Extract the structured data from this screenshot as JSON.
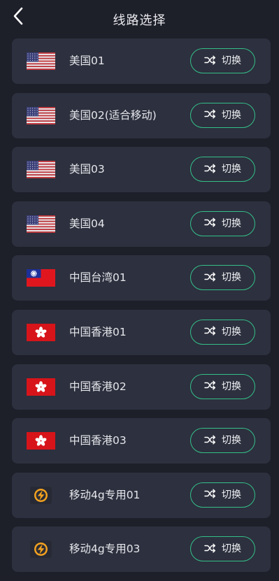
{
  "header": {
    "title": "线路选择",
    "back_icon": "chevron-left-icon"
  },
  "routes": [
    {
      "name": "美国01",
      "flag": "us"
    },
    {
      "name": "美国02(适合移动)",
      "flag": "us"
    },
    {
      "name": "美国03",
      "flag": "us"
    },
    {
      "name": "美国04",
      "flag": "us"
    },
    {
      "name": "中国台湾01",
      "flag": "tw"
    },
    {
      "name": "中国香港01",
      "flag": "hk"
    },
    {
      "name": "中国香港02",
      "flag": "hk"
    },
    {
      "name": "中国香港03",
      "flag": "hk"
    },
    {
      "name": "移动4g专用01",
      "flag": "bolt"
    },
    {
      "name": "移动4g专用03",
      "flag": "bolt"
    }
  ],
  "switch_button": {
    "label": "切换",
    "icon": "shuffle-icon"
  },
  "colors": {
    "background": "#1d1f29",
    "card": "#2d303e",
    "accent": "#33c08a"
  }
}
